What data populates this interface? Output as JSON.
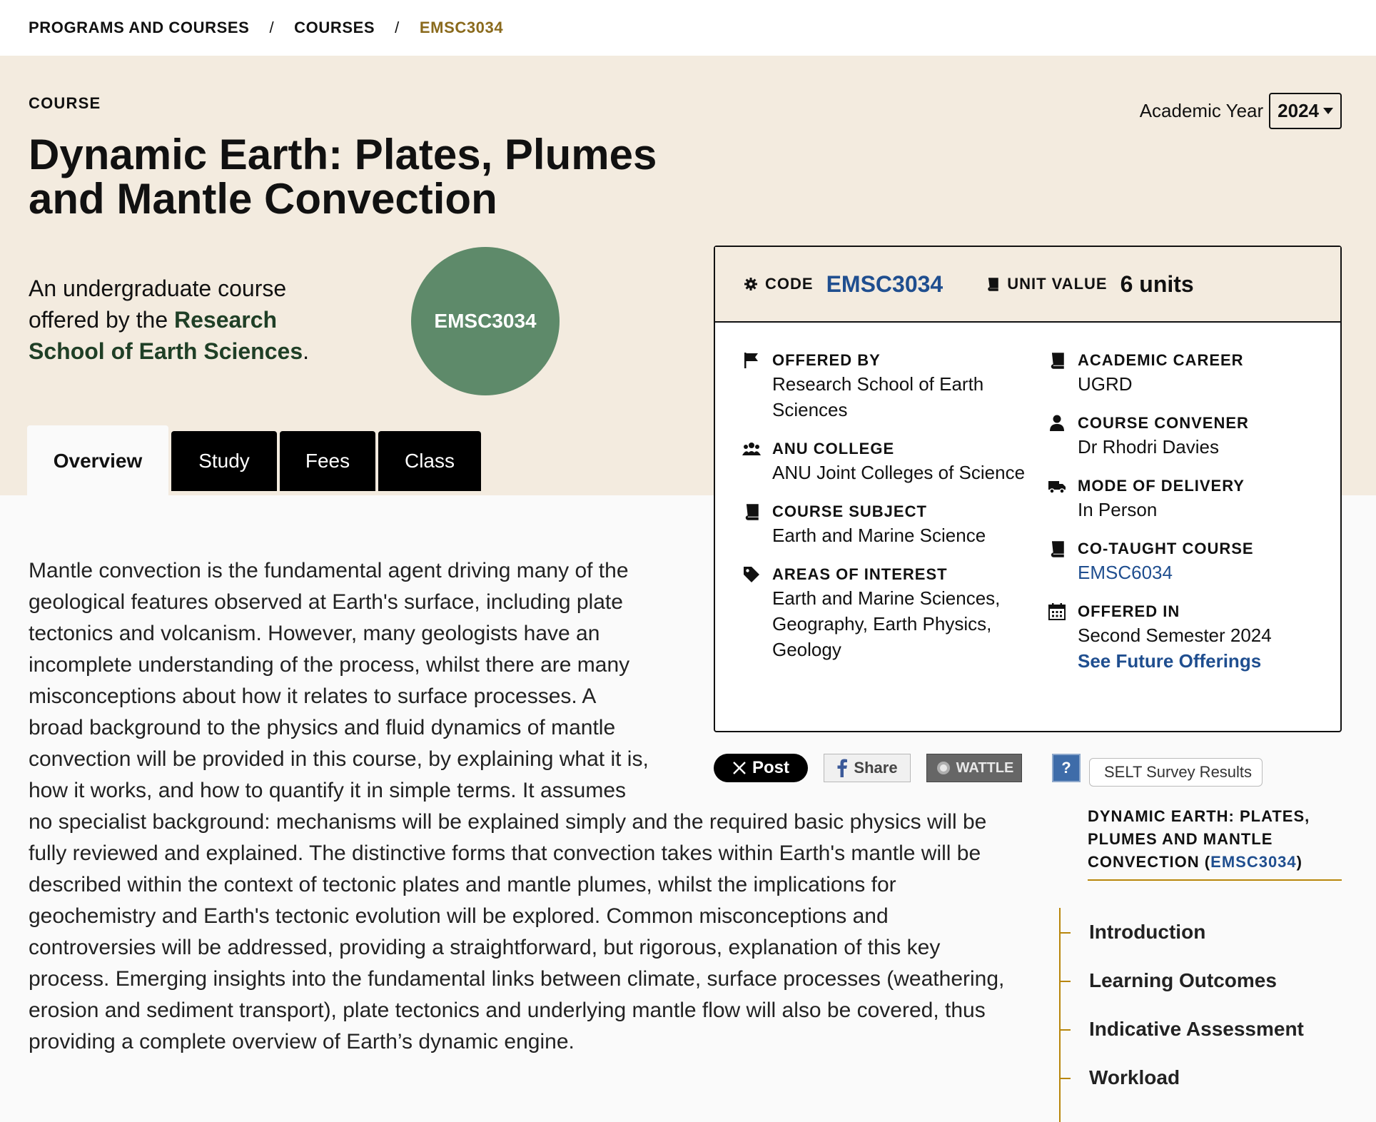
{
  "breadcrumb": {
    "items": [
      "PROGRAMS AND COURSES",
      "COURSES"
    ],
    "separator": "/",
    "current": "EMSC3034"
  },
  "hero": {
    "label": "COURSE",
    "title": "Dynamic Earth: Plates, Plumes and Mantle Convection",
    "intro_prefix": "An undergraduate course offered by the ",
    "intro_link": "Research School of Earth Sciences",
    "intro_suffix": ".",
    "badge": "EMSC3034"
  },
  "academic_year": {
    "label": "Academic Year",
    "value": "2024"
  },
  "tabs": [
    {
      "label": "Overview",
      "active": true
    },
    {
      "label": "Study",
      "active": false
    },
    {
      "label": "Fees",
      "active": false
    },
    {
      "label": "Class",
      "active": false
    }
  ],
  "card": {
    "code_label": "CODE",
    "code_value": "EMSC3034",
    "unit_label": "UNIT VALUE",
    "unit_value": "6 units",
    "offered_by": {
      "label": "OFFERED BY",
      "value": "Research School of Earth Sciences"
    },
    "anu_college": {
      "label": "ANU COLLEGE",
      "value": "ANU Joint Colleges of Science"
    },
    "course_subject": {
      "label": "COURSE SUBJECT",
      "value": "Earth and Marine Science"
    },
    "areas_of_interest": {
      "label": "AREAS OF INTEREST",
      "value": "Earth and Marine Sciences, Geography, Earth Physics, Geology"
    },
    "academic_career": {
      "label": "ACADEMIC CAREER",
      "value": "UGRD"
    },
    "course_convener": {
      "label": "COURSE CONVENER",
      "value": "Dr Rhodri Davies"
    },
    "mode_of_delivery": {
      "label": "MODE OF DELIVERY",
      "value": "In Person"
    },
    "co_taught": {
      "label": "CO-TAUGHT COURSE",
      "value": "EMSC6034"
    },
    "offered_in": {
      "label": "OFFERED IN",
      "value": "Second Semester 2024",
      "link": "See Future Offerings"
    }
  },
  "social": {
    "post": "Post",
    "share": "Share",
    "wattle": "WATTLE",
    "help": "?",
    "selt": "SELT Survey Results"
  },
  "description": "Mantle convection is the fundamental agent driving many of the geological features observed at Earth's surface, including plate tectonics and volcanism. However, many geologists have an incomplete understanding of the process, whilst there are many misconceptions about how it relates to surface processes. A broad background to the physics and fluid dynamics of mantle convection will be provided in this course, by explaining what it is, how it works, and how to quantify it in simple terms. It assumes no specialist background: mechanisms will be explained simply and the required basic physics will be fully reviewed and explained. The distinctive forms that convection takes within Earth's mantle will be described within the context of tectonic plates and mantle plumes, whilst the implications for geochemistry and Earth's tectonic evolution will be explored. Common misconceptions and controversies will be addressed, providing a straightforward, but rigorous, explanation of this key process. Emerging insights into the fundamental links between climate, surface processes (weathering, erosion and sediment transport), plate tectonics and underlying mantle flow will also be covered, thus providing a complete overview of Earth’s dynamic engine.",
  "sidebar": {
    "title": "DYNAMIC EARTH: PLATES, PLUMES AND MANTLE CONVECTION",
    "title_open": " (",
    "title_code": "EMSC3034",
    "title_close": ")",
    "nav": [
      "Introduction",
      "Learning Outcomes",
      "Indicative Assessment",
      "Workload"
    ]
  },
  "colors": {
    "hero_bg": "#f3ebdf",
    "link": "#1f4e8f",
    "accent": "#b8860b",
    "badge": "#5e8a6a"
  }
}
